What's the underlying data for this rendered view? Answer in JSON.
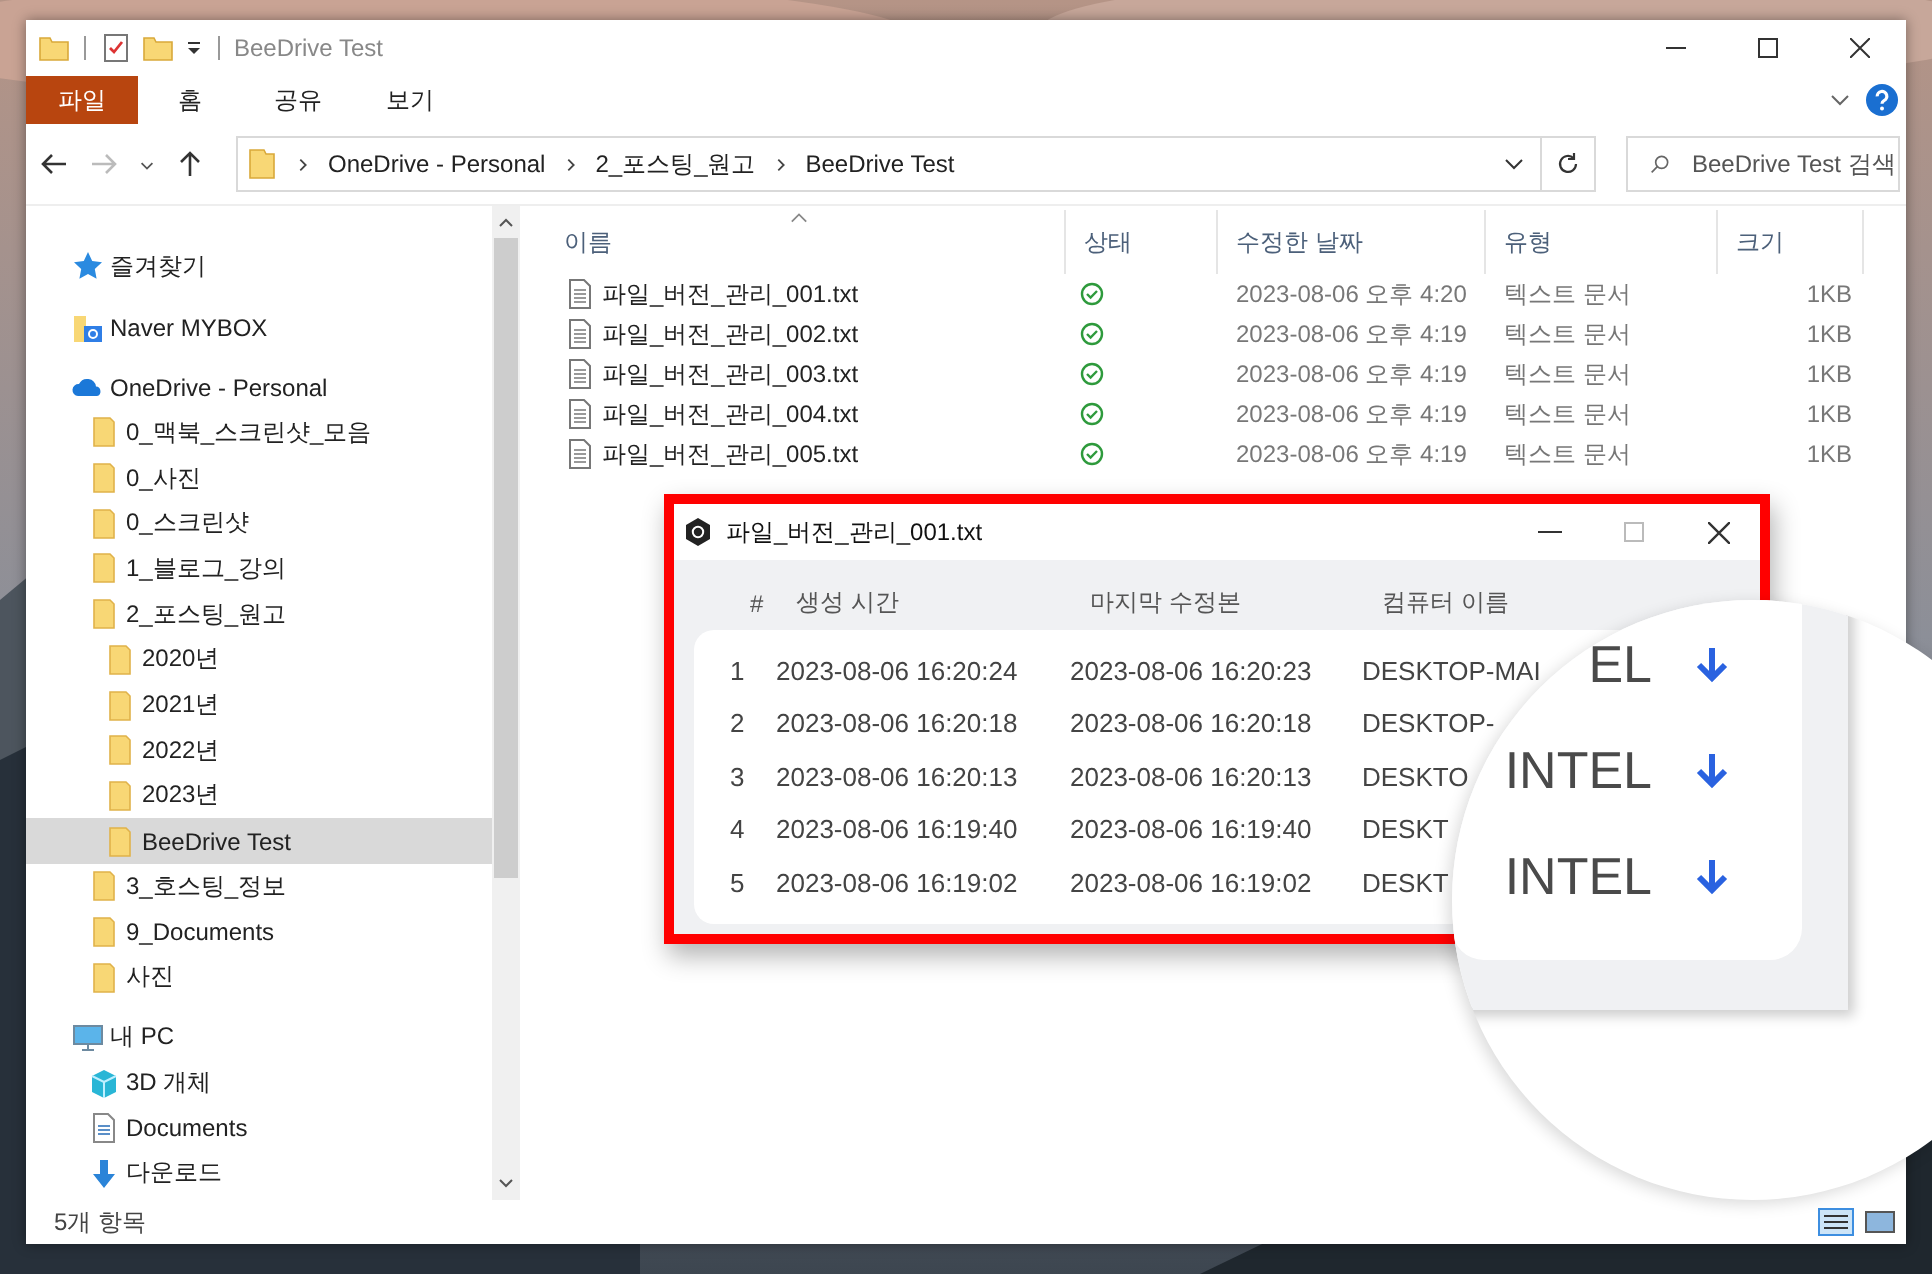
{
  "window": {
    "title": "BeeDrive Test"
  },
  "ribbon": {
    "tabs": [
      {
        "label": "파일",
        "selected": true
      },
      {
        "label": "홈",
        "selected": false
      },
      {
        "label": "공유",
        "selected": false
      },
      {
        "label": "보기",
        "selected": false
      }
    ]
  },
  "address": {
    "crumbs": [
      "OneDrive - Personal",
      "2_포스팅_원고",
      "BeeDrive Test"
    ],
    "search": {
      "placeholder": "BeeDrive Test 검색"
    }
  },
  "nav": [
    {
      "label": "즐겨찾기",
      "kind": "favorites",
      "selected": false
    },
    {
      "label": "Naver MYBOX",
      "kind": "mybox",
      "selected": false
    },
    {
      "label": "OneDrive - Personal",
      "kind": "onedrive",
      "selected": false,
      "children": [
        {
          "label": "0_맥북_스크린샷_모음",
          "kind": "folder",
          "selected": false
        },
        {
          "label": "0_사진",
          "kind": "folder",
          "selected": false
        },
        {
          "label": "0_스크린샷",
          "kind": "folder",
          "selected": false
        },
        {
          "label": "1_블로그_강의",
          "kind": "folder",
          "selected": false
        },
        {
          "label": "2_포스팅_원고",
          "kind": "folder",
          "selected": false,
          "children": [
            {
              "label": "2020년",
              "kind": "folder",
              "selected": false
            },
            {
              "label": "2021년",
              "kind": "folder",
              "selected": false
            },
            {
              "label": "2022년",
              "kind": "folder",
              "selected": false
            },
            {
              "label": "2023년",
              "kind": "folder",
              "selected": false
            },
            {
              "label": "BeeDrive Test",
              "kind": "folder",
              "selected": true
            }
          ]
        },
        {
          "label": "3_호스팅_정보",
          "kind": "folder",
          "selected": false
        },
        {
          "label": "9_Documents",
          "kind": "folder",
          "selected": false
        },
        {
          "label": "사진",
          "kind": "folder",
          "selected": false
        }
      ]
    },
    {
      "label": "내 PC",
      "kind": "pc",
      "selected": false,
      "children": [
        {
          "label": "3D 개체",
          "kind": "cube",
          "selected": false
        },
        {
          "label": "Documents",
          "kind": "documents",
          "selected": false
        },
        {
          "label": "다운로드",
          "kind": "download",
          "selected": false
        }
      ]
    }
  ],
  "files": {
    "columns": [
      "이름",
      "상태",
      "수정한 날짜",
      "유형",
      "크기"
    ],
    "rows": [
      {
        "name": "파일_버전_관리_001.txt",
        "synced": true,
        "modified": "2023-08-06 오후 4:20",
        "type": "텍스트 문서",
        "size": "1KB"
      },
      {
        "name": "파일_버전_관리_002.txt",
        "synced": true,
        "modified": "2023-08-06 오후 4:19",
        "type": "텍스트 문서",
        "size": "1KB"
      },
      {
        "name": "파일_버전_관리_003.txt",
        "synced": true,
        "modified": "2023-08-06 오후 4:19",
        "type": "텍스트 문서",
        "size": "1KB"
      },
      {
        "name": "파일_버전_관리_004.txt",
        "synced": true,
        "modified": "2023-08-06 오후 4:19",
        "type": "텍스트 문서",
        "size": "1KB"
      },
      {
        "name": "파일_버전_관리_005.txt",
        "synced": true,
        "modified": "2023-08-06 오후 4:19",
        "type": "텍스트 문서",
        "size": "1KB"
      }
    ]
  },
  "status_bar": {
    "count": "5개 항목"
  },
  "dialog": {
    "title": "파일_버전_관리_001.txt",
    "columns": [
      "#",
      "생성 시간",
      "마지막 수정본",
      "컴퓨터 이름"
    ],
    "rows": [
      {
        "index": "1",
        "created": "2023-08-06 16:20:24",
        "modified": "2023-08-06 16:20:23",
        "computer": "DESKTOP-MAI",
        "magnified": "EL",
        "download": true
      },
      {
        "index": "2",
        "created": "2023-08-06 16:20:18",
        "modified": "2023-08-06 16:20:18",
        "computer": "DESKTOP-"
      },
      {
        "index": "3",
        "created": "2023-08-06 16:20:13",
        "modified": "2023-08-06 16:20:13",
        "computer": "DESKTO",
        "magnified": "INTEL",
        "download": true
      },
      {
        "index": "4",
        "created": "2023-08-06 16:19:40",
        "modified": "2023-08-06 16:19:40",
        "computer": "DESKT"
      },
      {
        "index": "5",
        "created": "2023-08-06 16:19:02",
        "modified": "2023-08-06 16:19:02",
        "computer": "DESKT",
        "magnified": "INTEL",
        "download": true
      }
    ]
  }
}
